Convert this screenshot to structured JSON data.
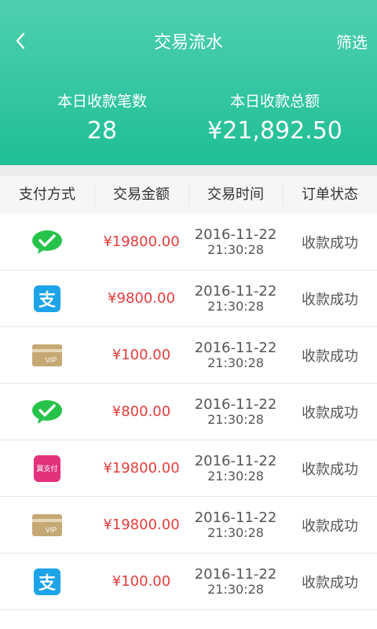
{
  "header": {
    "title": "交易流水",
    "filter_label": "筛选",
    "stats": [
      {
        "label": "本日收款笔数",
        "value": "28"
      },
      {
        "label": "本日收款总额",
        "value": "¥21,892.50"
      }
    ]
  },
  "columns": [
    "支付方式",
    "交易金额",
    "交易时间",
    "订单状态"
  ],
  "rows": [
    {
      "method_icon": "wechat-pay-icon",
      "amount": "¥19800.00",
      "date": "2016-11-22",
      "time": "21:30:28",
      "status": "收款成功"
    },
    {
      "method_icon": "alipay-icon",
      "amount": "¥9800.00",
      "date": "2016-11-22",
      "time": "21:30:28",
      "status": "收款成功"
    },
    {
      "method_icon": "vip-card-icon",
      "amount": "¥100.00",
      "date": "2016-11-22",
      "time": "21:30:28",
      "status": "收款成功"
    },
    {
      "method_icon": "wechat-pay-icon",
      "amount": "¥800.00",
      "date": "2016-11-22",
      "time": "21:30:28",
      "status": "收款成功"
    },
    {
      "method_icon": "yizhifu-icon",
      "amount": "¥19800.00",
      "date": "2016-11-22",
      "time": "21:30:28",
      "status": "收款成功"
    },
    {
      "method_icon": "vip-card-icon",
      "amount": "¥19800.00",
      "date": "2016-11-22",
      "time": "21:30:28",
      "status": "收款成功"
    },
    {
      "method_icon": "alipay-icon",
      "amount": "¥100.00",
      "date": "2016-11-22",
      "time": "21:30:28",
      "status": "收款成功"
    }
  ],
  "icon_text": {
    "alipay": "支",
    "vip": "VIP",
    "yizhifu": "翼支付"
  },
  "colors": {
    "header_top": "#4fcfb1",
    "header_bottom": "#1fbf95",
    "amount": "#e33d3d",
    "wechat": "#26c34a",
    "alipay": "#1da3e8",
    "card": "#c5a874",
    "yizhifu": "#e2327b"
  }
}
